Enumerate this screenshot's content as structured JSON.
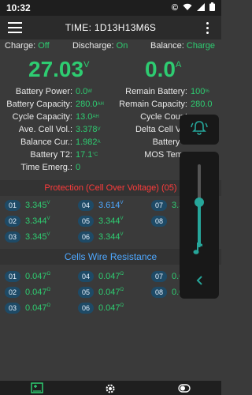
{
  "status": {
    "time": "10:32",
    "icons": [
      "copyright-icon",
      "wifi-icon",
      "signal-icon",
      "battery-icon"
    ]
  },
  "appbar": {
    "title": "TIME: 1D13H13M6S"
  },
  "modes": {
    "charge_label": "Charge:",
    "charge_value": "Off",
    "discharge_label": "Discharge:",
    "discharge_value": "On",
    "balance_label": "Balance:",
    "balance_value": "Charge"
  },
  "readings": {
    "voltage": "27.03",
    "voltage_unit": "V",
    "current": "0.0",
    "current_unit": "A"
  },
  "left_stats": [
    {
      "label": "Battery Power:",
      "value": "0.0",
      "unit": "W"
    },
    {
      "label": "Battery Capacity:",
      "value": "280.0",
      "unit": "AH"
    },
    {
      "label": "Cycle Capacity:",
      "value": "13.0",
      "unit": "AH"
    },
    {
      "label": "Ave. Cell Vol.:",
      "value": "3.378",
      "unit": "V"
    },
    {
      "label": "Balance Cur.:",
      "value": "1.982",
      "unit": "A"
    },
    {
      "label": "Battery T2:",
      "value": "17.1",
      "unit": "°C"
    },
    {
      "label": "Time Emerg.:",
      "value": "0",
      "unit": ""
    }
  ],
  "right_stats": [
    {
      "label": "Remain Battery:",
      "value": "100",
      "unit": "%"
    },
    {
      "label": "Remain Capacity:",
      "value": "280.0",
      "unit": ""
    },
    {
      "label": "Cycle Count",
      "value": "",
      "unit": ""
    },
    {
      "label": "Delta Cell Vol",
      "value": "",
      "unit": ""
    },
    {
      "label": "Battery T",
      "value": "",
      "unit": ""
    },
    {
      "label": "MOS Temp",
      "value": "",
      "unit": ""
    }
  ],
  "protection": {
    "text": "Protection (Cell Over Voltage) (05)",
    "color": "#ff3b3b"
  },
  "cells": [
    {
      "num": "01",
      "value": "3.345",
      "unit": "V"
    },
    {
      "num": "04",
      "value": "3.614",
      "unit": "V",
      "highlight": true
    },
    {
      "num": "07",
      "value": "3.3",
      "unit": ""
    },
    {
      "num": "02",
      "value": "3.344",
      "unit": "V"
    },
    {
      "num": "05",
      "value": "3.344",
      "unit": "V"
    },
    {
      "num": "08",
      "value": "",
      "unit": ""
    },
    {
      "num": "03",
      "value": "3.345",
      "unit": "V"
    },
    {
      "num": "06",
      "value": "3.344",
      "unit": "V"
    }
  ],
  "wire": {
    "title": "Cells Wire Resistance",
    "cells": [
      {
        "num": "01",
        "value": "0.047",
        "unit": "Ω"
      },
      {
        "num": "04",
        "value": "0.047",
        "unit": "Ω"
      },
      {
        "num": "07",
        "value": "0.0",
        "unit": ""
      },
      {
        "num": "02",
        "value": "0.047",
        "unit": "Ω"
      },
      {
        "num": "05",
        "value": "0.047",
        "unit": "Ω"
      },
      {
        "num": "08",
        "value": "0.0",
        "unit": ""
      },
      {
        "num": "03",
        "value": "0.047",
        "unit": "Ω"
      },
      {
        "num": "06",
        "value": "0.047",
        "unit": "Ω"
      }
    ]
  },
  "volume": {
    "level_fraction": 0.55
  },
  "colors": {
    "accent": "#2ecc71",
    "teal": "#26a69a",
    "pill": "#1e4a66",
    "alert": "#ff3b3b",
    "highlight": "#4ea8ff"
  }
}
